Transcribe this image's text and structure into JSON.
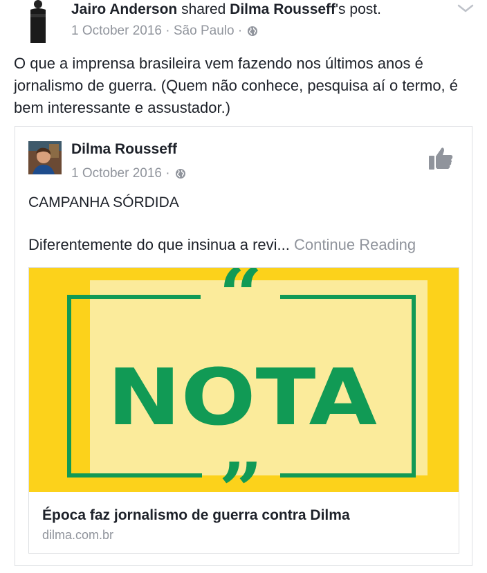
{
  "post": {
    "author": "Jairo Anderson",
    "shared_word": "shared",
    "original_author_possessive": "Dilma Rousseff",
    "post_suffix": "'s post.",
    "date": "1 October 2016",
    "separator": "·",
    "location": "São Paulo",
    "text": "O que a imprensa brasileira vem fazendo nos últimos anos é jornalismo de guerra. (Quem não conhece, pesquisa aí o termo, é bem interessante e assustador.)"
  },
  "shared": {
    "author": "Dilma Rousseff",
    "date": "1 October 2016",
    "separator": "·",
    "title": "CAMPANHA SÓRDIDA",
    "snippet": "Diferentemente do que insinua a revi...",
    "continue_label": "Continue Reading"
  },
  "link": {
    "image_text": "NOTA",
    "title": "Época faz jornalismo de guerra contra Dilma",
    "domain": "dilma.com.br"
  },
  "colors": {
    "yellow": "#fcd21b",
    "pale_yellow": "#fbeb9b",
    "green": "#119a55",
    "meta_gray": "#90949c"
  },
  "icons": [
    "globe-icon",
    "chevron-down-icon",
    "thumbs-up-icon"
  ]
}
